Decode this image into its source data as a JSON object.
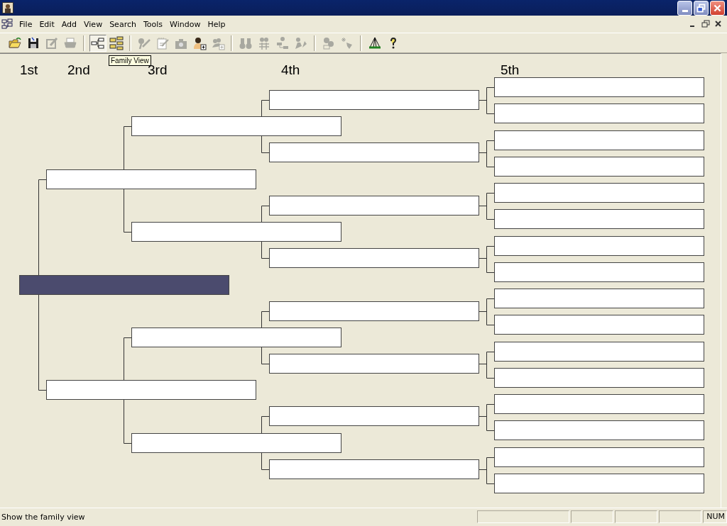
{
  "menu": [
    "File",
    "Edit",
    "Add",
    "View",
    "Search",
    "Tools",
    "Window",
    "Help"
  ],
  "toolbar": [
    {
      "kind": "open",
      "disabled": false,
      "selected": false
    },
    {
      "kind": "save",
      "disabled": false,
      "selected": false
    },
    {
      "kind": "edit",
      "disabled": true,
      "selected": false
    },
    {
      "kind": "print",
      "disabled": true,
      "selected": false
    },
    {
      "kind": "separator"
    },
    {
      "kind": "pedigree",
      "disabled": false,
      "selected": true
    },
    {
      "kind": "family",
      "disabled": false,
      "selected": false
    },
    {
      "kind": "separator"
    },
    {
      "kind": "pen",
      "disabled": true,
      "selected": false
    },
    {
      "kind": "notes",
      "disabled": true,
      "selected": false
    },
    {
      "kind": "scrapbook",
      "disabled": true,
      "selected": false
    },
    {
      "kind": "add-person",
      "disabled": false,
      "selected": false
    },
    {
      "kind": "add-group",
      "disabled": true,
      "selected": false
    },
    {
      "kind": "separator"
    },
    {
      "kind": "find",
      "disabled": true,
      "selected": false
    },
    {
      "kind": "find-grid",
      "disabled": true,
      "selected": false
    },
    {
      "kind": "find-tree",
      "disabled": true,
      "selected": false
    },
    {
      "kind": "go",
      "disabled": true,
      "selected": false
    },
    {
      "kind": "separator"
    },
    {
      "kind": "merge",
      "disabled": true,
      "selected": false
    },
    {
      "kind": "new",
      "disabled": true,
      "selected": false
    },
    {
      "kind": "separator"
    },
    {
      "kind": "tree-chart",
      "disabled": false,
      "selected": false
    },
    {
      "kind": "help",
      "disabled": false,
      "selected": false
    }
  ],
  "tooltip": {
    "text": "Family View"
  },
  "chart": {
    "generation_labels": [
      "1st",
      "2nd",
      "3rd",
      "4th",
      "5th"
    ],
    "pedigree": {
      "selected": true,
      "children": [
        {
          "selected": false,
          "children": [
            {
              "selected": false,
              "children": [
                {
                  "selected": false,
                  "children": [
                    {
                      "selected": false
                    },
                    {
                      "selected": false
                    }
                  ]
                },
                {
                  "selected": false,
                  "children": [
                    {
                      "selected": false
                    },
                    {
                      "selected": false
                    }
                  ]
                }
              ]
            },
            {
              "selected": false,
              "children": [
                {
                  "selected": false,
                  "children": [
                    {
                      "selected": false
                    },
                    {
                      "selected": false
                    }
                  ]
                },
                {
                  "selected": false,
                  "children": [
                    {
                      "selected": false
                    },
                    {
                      "selected": false
                    }
                  ]
                }
              ]
            }
          ]
        },
        {
          "selected": false,
          "children": [
            {
              "selected": false,
              "children": [
                {
                  "selected": false,
                  "children": [
                    {
                      "selected": false
                    },
                    {
                      "selected": false
                    }
                  ]
                },
                {
                  "selected": false,
                  "children": [
                    {
                      "selected": false
                    },
                    {
                      "selected": false
                    }
                  ]
                }
              ]
            },
            {
              "selected": false,
              "children": [
                {
                  "selected": false,
                  "children": [
                    {
                      "selected": false
                    },
                    {
                      "selected": false
                    }
                  ]
                },
                {
                  "selected": false,
                  "children": [
                    {
                      "selected": false
                    },
                    {
                      "selected": false
                    }
                  ]
                }
              ]
            }
          ]
        }
      ]
    }
  },
  "status_bar": {
    "message": "Show the family view",
    "indicators": [
      "NUM"
    ]
  }
}
